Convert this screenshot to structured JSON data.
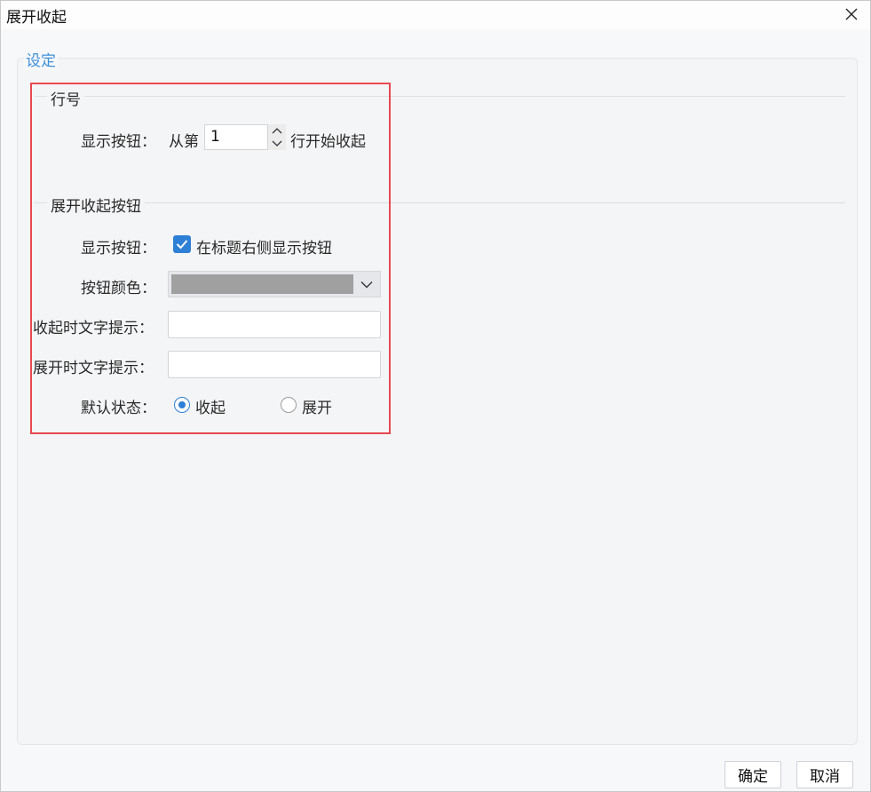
{
  "window": {
    "title": "展开收起"
  },
  "settings": {
    "legend": "设定"
  },
  "row_number": {
    "section_title": "行号",
    "show_button_label": "显示按钮：",
    "from_text": "从第",
    "start_value": "1",
    "suffix_text": "行开始收起"
  },
  "toggle_button": {
    "section_title": "展开收起按钮",
    "show_button_label": "显示按钮：",
    "show_on_title_right": {
      "label": "在标题右侧显示按钮",
      "checked": true
    },
    "button_color_label": "按钮颜色：",
    "button_color": "#a0a0a0",
    "collapse_tip_label": "收起时文字提示：",
    "collapse_tip_value": "",
    "expand_tip_label": "展开时文字提示：",
    "expand_tip_value": "",
    "default_state_label": "默认状态：",
    "states": [
      {
        "label": "收起",
        "selected": true
      },
      {
        "label": "展开",
        "selected": false
      }
    ]
  },
  "footer": {
    "ok": "确定",
    "cancel": "取消"
  },
  "colors": {
    "accent": "#2e7fd6",
    "legend": "#3f8fd8",
    "highlight": "#e8494f"
  }
}
